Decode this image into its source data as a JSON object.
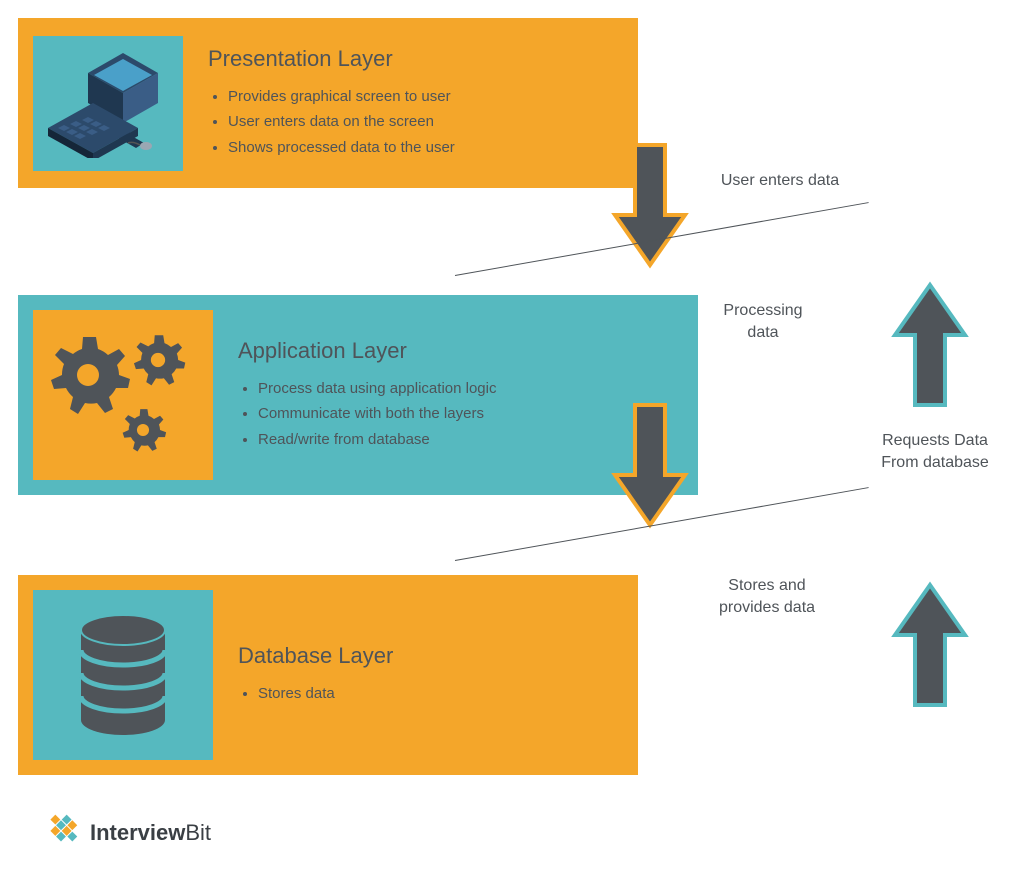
{
  "layers": {
    "presentation": {
      "title": "Presentation Layer",
      "bullets": [
        "Provides graphical screen to user",
        "User enters data on the screen",
        "Shows processed data to the user"
      ]
    },
    "application": {
      "title": "Application Layer",
      "bullets": [
        "Process data using application logic",
        "Communicate with both the layers",
        "Read/write from database"
      ]
    },
    "database": {
      "title": "Database Layer",
      "bullets": [
        "Stores data"
      ]
    }
  },
  "annotations": {
    "user_enters_data": "User enters data",
    "processing_data": "Processing data",
    "requests_data": "Requests Data From database",
    "stores_provides": "Stores and provides data"
  },
  "logo": {
    "name_bold": "Interview",
    "name_rest": "Bit"
  },
  "colors": {
    "orange": "#f4a62a",
    "teal": "#56b9bf",
    "dark": "#4f5459"
  }
}
